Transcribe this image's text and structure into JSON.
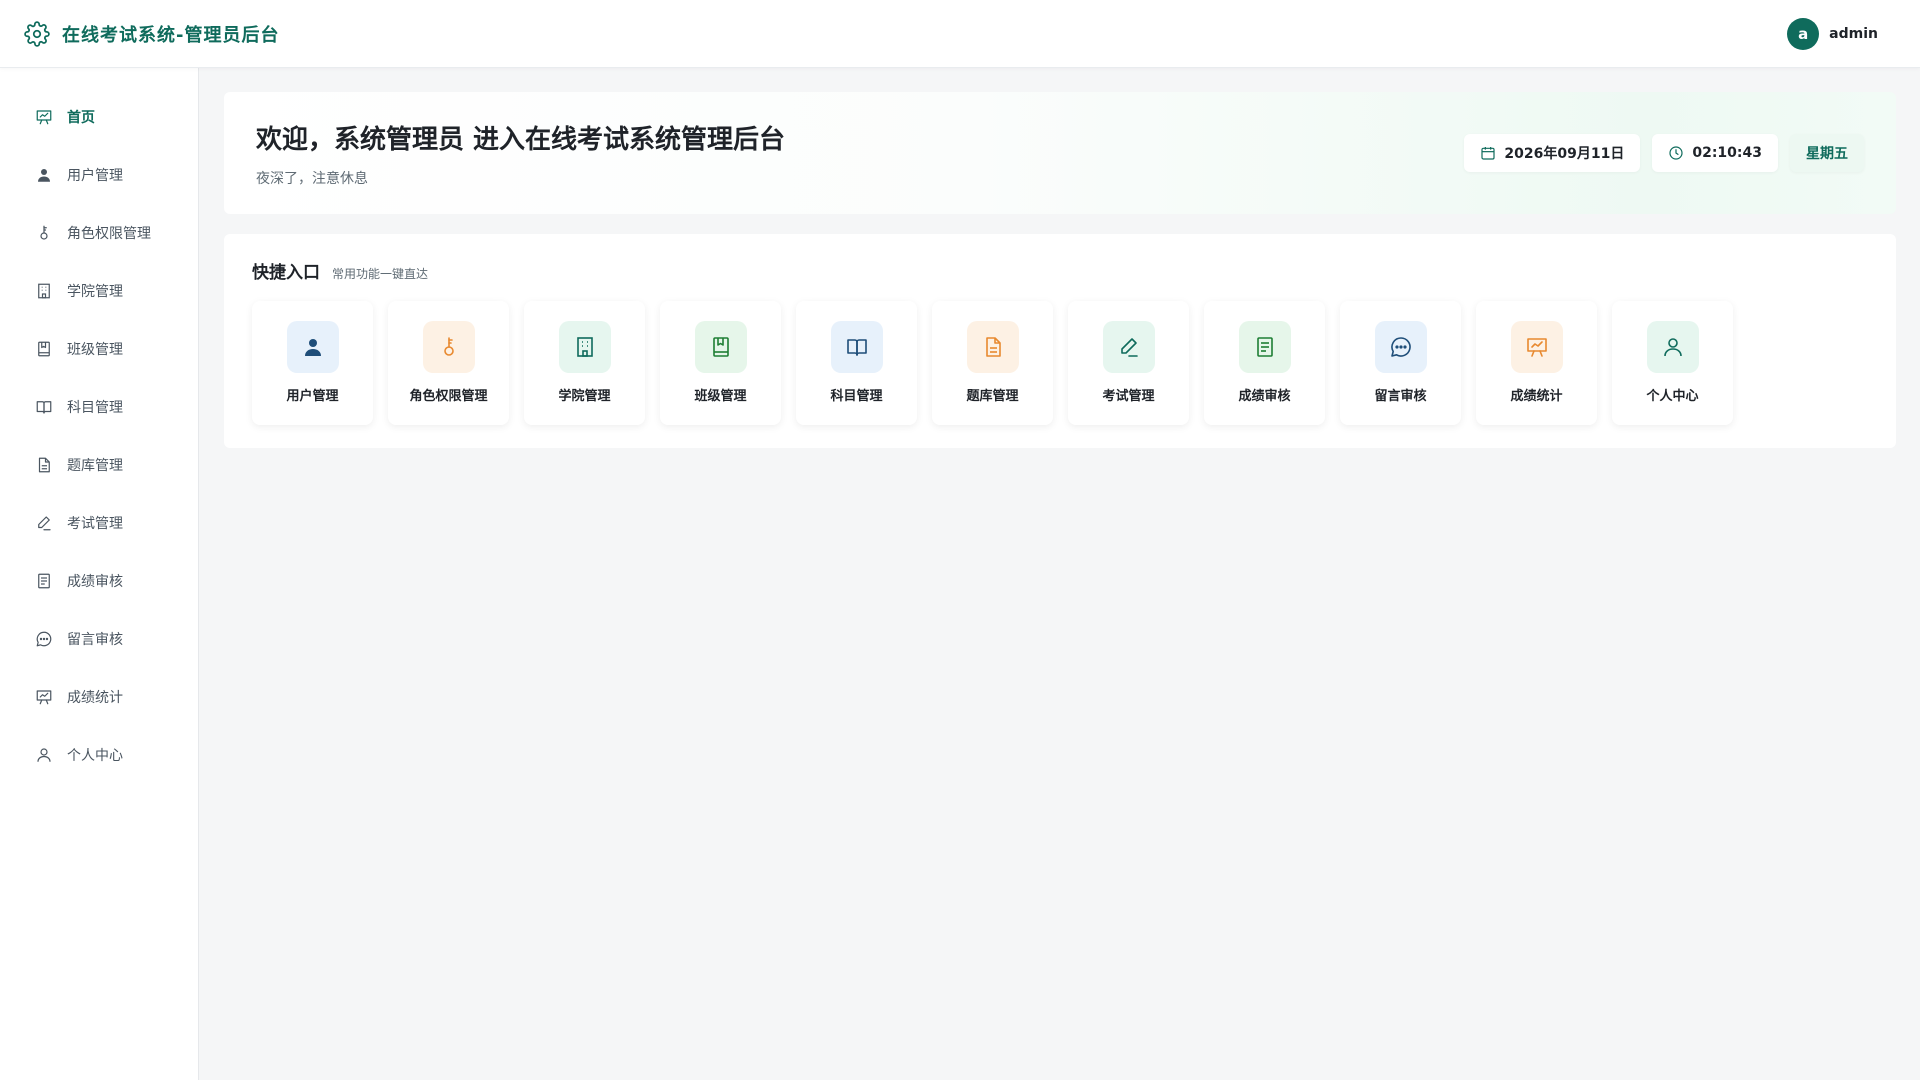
{
  "app": {
    "title": "在线考试系统-管理员后台",
    "icon": "gear-icon"
  },
  "user": {
    "avatar_letter": "a",
    "name": "admin"
  },
  "sidebar": {
    "items": [
      {
        "label": "首页",
        "icon": "presentation-chart-icon",
        "active": true
      },
      {
        "label": "用户管理",
        "icon": "user-filled-icon"
      },
      {
        "label": "角色权限管理",
        "icon": "key-icon"
      },
      {
        "label": "学院管理",
        "icon": "building-icon"
      },
      {
        "label": "班级管理",
        "icon": "bookmark-book-icon"
      },
      {
        "label": "科目管理",
        "icon": "open-book-icon"
      },
      {
        "label": "题库管理",
        "icon": "document-icon"
      },
      {
        "label": "考试管理",
        "icon": "pen-icon"
      },
      {
        "label": "成绩审核",
        "icon": "list-document-icon"
      },
      {
        "label": "留言审核",
        "icon": "chat-bubble-icon"
      },
      {
        "label": "成绩统计",
        "icon": "presentation-chart-icon"
      },
      {
        "label": "个人中心",
        "icon": "user-outline-icon"
      }
    ]
  },
  "welcome": {
    "title": "欢迎，系统管理员 进入在线考试系统管理后台",
    "subtitle": "夜深了，注意休息",
    "date": "2026年09月11日",
    "time": "02:10:43",
    "weekday": "星期五"
  },
  "quick": {
    "title": "快捷入口",
    "subtitle": "常用功能一键直达",
    "cards": [
      {
        "label": "用户管理",
        "icon": "user-filled-icon",
        "color": "#1f4e79",
        "bg": "#e7f1fb"
      },
      {
        "label": "角色权限管理",
        "icon": "key-icon",
        "color": "#e8892f",
        "bg": "#fdf1e4"
      },
      {
        "label": "学院管理",
        "icon": "building-icon",
        "color": "#0f6b5c",
        "bg": "#e6f6ef"
      },
      {
        "label": "班级管理",
        "icon": "bookmark-book-icon",
        "color": "#1e7e34",
        "bg": "#e6f6ea"
      },
      {
        "label": "科目管理",
        "icon": "open-book-icon",
        "color": "#1f4e79",
        "bg": "#e7f1fb"
      },
      {
        "label": "题库管理",
        "icon": "document-icon",
        "color": "#e8892f",
        "bg": "#fdf1e4"
      },
      {
        "label": "考试管理",
        "icon": "pen-icon",
        "color": "#0f6b5c",
        "bg": "#e6f6ef"
      },
      {
        "label": "成绩审核",
        "icon": "list-document-icon",
        "color": "#1e7e34",
        "bg": "#e6f6ea"
      },
      {
        "label": "留言审核",
        "icon": "chat-bubble-icon",
        "color": "#1f4e79",
        "bg": "#e7f1fb"
      },
      {
        "label": "成绩统计",
        "icon": "presentation-chart-icon",
        "color": "#e8892f",
        "bg": "#fdf1e4"
      },
      {
        "label": "个人中心",
        "icon": "user-outline-icon",
        "color": "#0f6b5c",
        "bg": "#e6f6ef"
      }
    ]
  },
  "colors": {
    "primary": "#0f6b5c",
    "sidebar_text": "#4a5560",
    "background": "#f5f6f7"
  }
}
